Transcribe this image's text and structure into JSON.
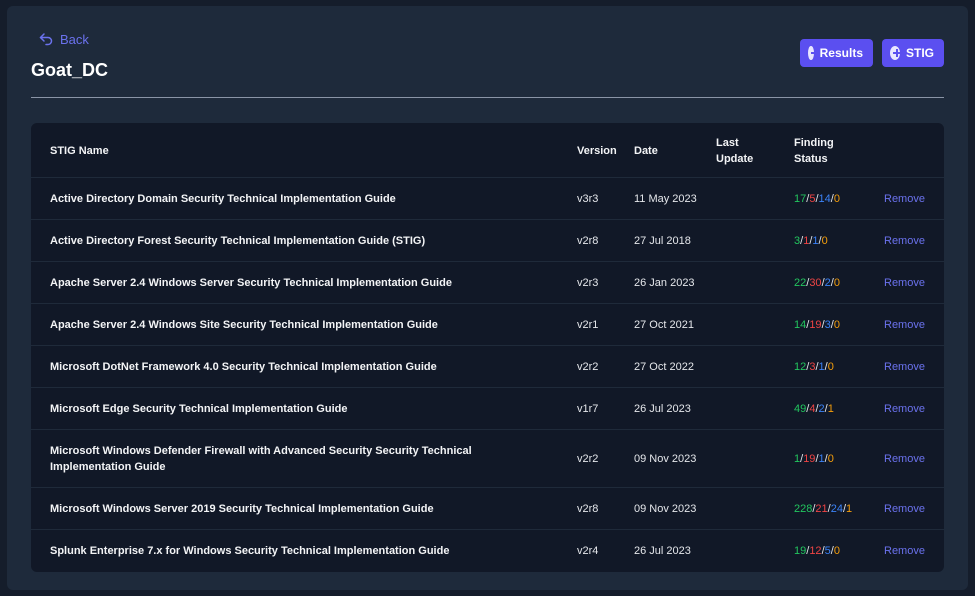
{
  "header": {
    "back_label": "Back",
    "title": "Goat_DC",
    "results_button_label": "Results",
    "stig_button_label": "STIG"
  },
  "colors": {
    "accent": "#5b4ff0",
    "link": "#6b72ee",
    "status_green": "#22c55e",
    "status_red": "#ef4444",
    "status_blue": "#3b82f6",
    "status_orange": "#f59e0b"
  },
  "table": {
    "headers": {
      "name": "STIG Name",
      "version": "Version",
      "date": "Date",
      "last_update_1": "Last",
      "last_update_2": "Update",
      "finding_status_1": "Finding",
      "finding_status_2": "Status"
    },
    "remove_label": "Remove",
    "rows": [
      {
        "name": "Active Directory Domain Security Technical Implementation Guide",
        "version": "v3r3",
        "date": "11 May 2023",
        "last_update": "",
        "status": {
          "g": "17",
          "r": "5",
          "b": "14",
          "o": "0"
        }
      },
      {
        "name": "Active Directory Forest Security Technical Implementation Guide (STIG)",
        "version": "v2r8",
        "date": "27 Jul 2018",
        "last_update": "",
        "status": {
          "g": "3",
          "r": "1",
          "b": "1",
          "o": "0"
        }
      },
      {
        "name": "Apache Server 2.4 Windows Server Security Technical Implementation Guide",
        "version": "v2r3",
        "date": "26 Jan 2023",
        "last_update": "",
        "status": {
          "g": "22",
          "r": "30",
          "b": "2",
          "o": "0"
        }
      },
      {
        "name": "Apache Server 2.4 Windows Site Security Technical Implementation Guide",
        "version": "v2r1",
        "date": "27 Oct 2021",
        "last_update": "",
        "status": {
          "g": "14",
          "r": "19",
          "b": "3",
          "o": "0"
        }
      },
      {
        "name": "Microsoft DotNet Framework 4.0 Security Technical Implementation Guide",
        "version": "v2r2",
        "date": "27 Oct 2022",
        "last_update": "",
        "status": {
          "g": "12",
          "r": "3",
          "b": "1",
          "o": "0"
        }
      },
      {
        "name": "Microsoft Edge Security Technical Implementation Guide",
        "version": "v1r7",
        "date": "26 Jul 2023",
        "last_update": "",
        "status": {
          "g": "49",
          "r": "4",
          "b": "2",
          "o": "1"
        }
      },
      {
        "name": "Microsoft Windows Defender Firewall with Advanced Security Security Technical Implementation Guide",
        "version": "v2r2",
        "date": "09 Nov 2023",
        "last_update": "",
        "status": {
          "g": "1",
          "r": "19",
          "b": "1",
          "o": "0"
        }
      },
      {
        "name": "Microsoft Windows Server 2019 Security Technical Implementation Guide",
        "version": "v2r8",
        "date": "09 Nov 2023",
        "last_update": "",
        "status": {
          "g": "228",
          "r": "21",
          "b": "24",
          "o": "1"
        }
      },
      {
        "name": "Splunk Enterprise 7.x for Windows Security Technical Implementation Guide",
        "version": "v2r4",
        "date": "26 Jul 2023",
        "last_update": "",
        "status": {
          "g": "19",
          "r": "12",
          "b": "5",
          "o": "0"
        }
      }
    ]
  }
}
